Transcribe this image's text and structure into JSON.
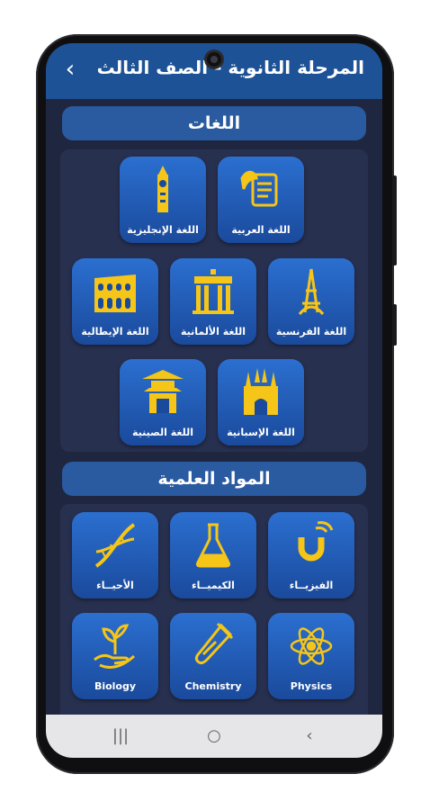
{
  "header": {
    "title": "المرحلة الثانوية - الصف الثالث",
    "back_icon": "chevron-left-icon"
  },
  "sections": {
    "languages": {
      "title": "اللغات",
      "items": [
        {
          "label": "اللغة العربية",
          "icon": "scroll-quill-icon"
        },
        {
          "label": "اللغة الإنجليزية",
          "icon": "big-ben-icon"
        },
        {
          "label": "اللغة الفرنسية",
          "icon": "eiffel-tower-icon"
        },
        {
          "label": "اللغة الألمانية",
          "icon": "brandenburg-gate-icon"
        },
        {
          "label": "اللغة الإيطالية",
          "icon": "colosseum-icon"
        },
        {
          "label": "اللغة الإسبانية",
          "icon": "sagrada-familia-icon"
        },
        {
          "label": "اللغة الصينية",
          "icon": "pagoda-icon"
        }
      ]
    },
    "sciences": {
      "title": "المواد العلمية",
      "items": [
        {
          "label": "الفيزيــاء",
          "icon": "magnet-icon"
        },
        {
          "label": "الكيميــاء",
          "icon": "flask-icon"
        },
        {
          "label": "الأحيــاء",
          "icon": "dna-icon"
        },
        {
          "label": "Physics",
          "icon": "atom-icon"
        },
        {
          "label": "Chemistry",
          "icon": "test-tube-icon"
        },
        {
          "label": "Biology",
          "icon": "plant-hand-icon"
        }
      ]
    }
  },
  "nav": {
    "recent": "|||",
    "home": "○",
    "back": "‹"
  },
  "colors": {
    "appbar": "#1e5296",
    "tile": "#2b6fd0",
    "icon": "#f5c518",
    "panel": "#283050"
  }
}
